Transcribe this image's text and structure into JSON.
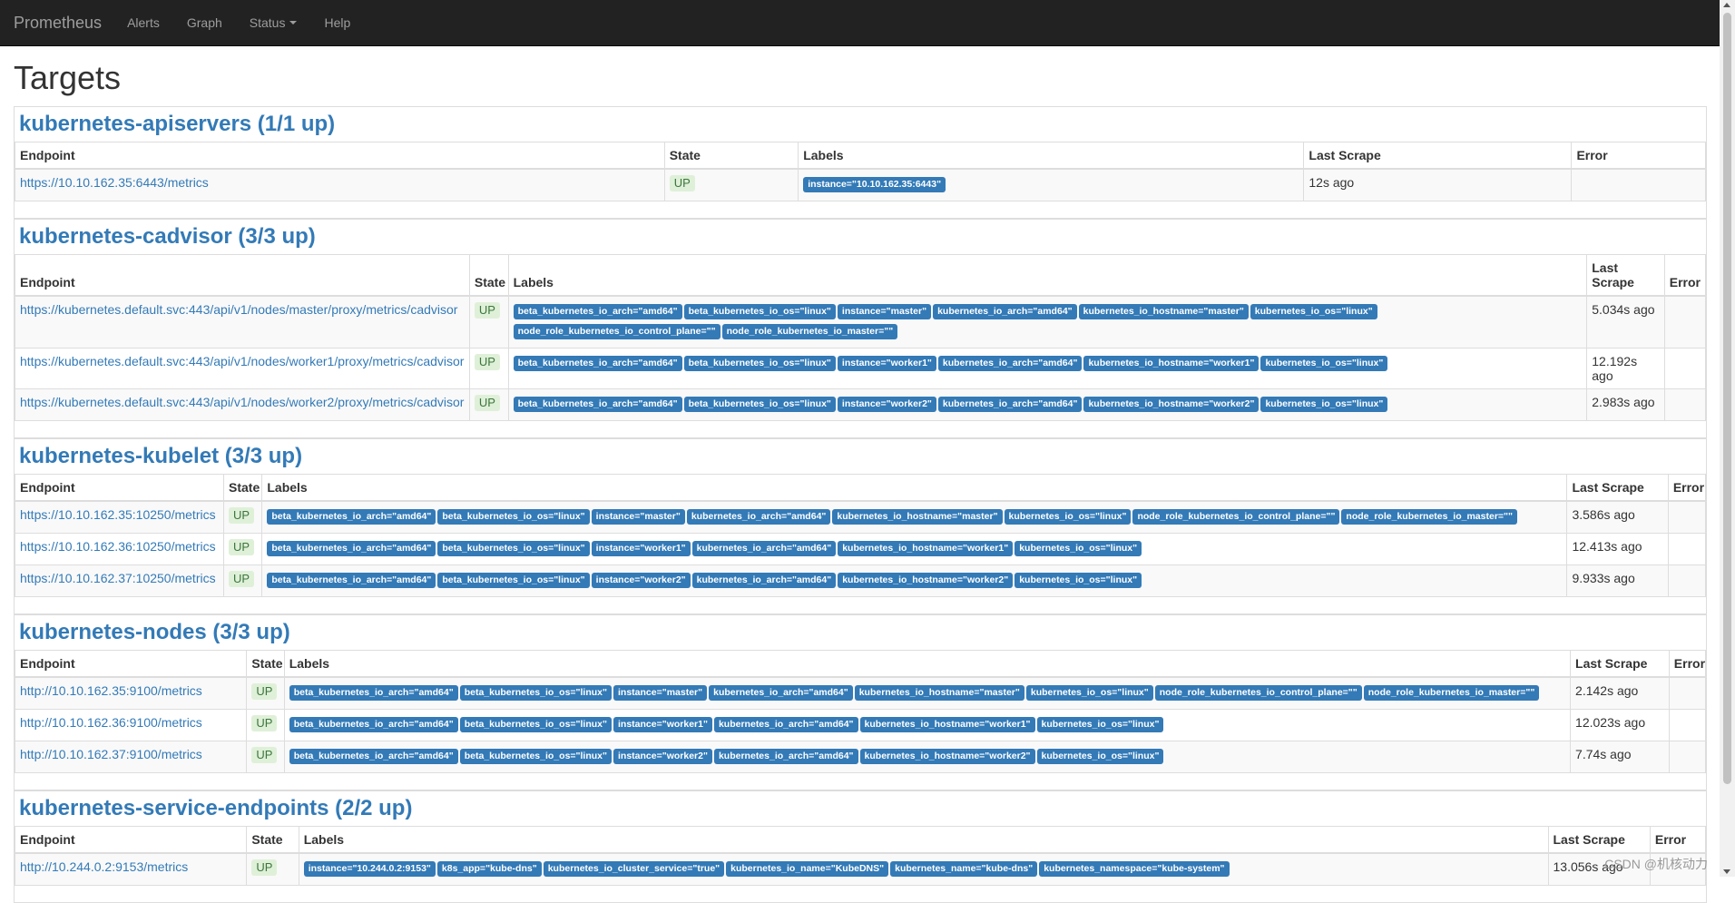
{
  "nav": {
    "brand": "Prometheus",
    "alerts": "Alerts",
    "graph": "Graph",
    "status": "Status",
    "help": "Help"
  },
  "page_title": "Targets",
  "sections": [
    {
      "title": "kubernetes-apiservers (1/1 up)",
      "headers": {
        "endpoint": "Endpoint",
        "state": "State",
        "labels": "Labels",
        "last_scrape": "Last Scrape",
        "error": "Error"
      },
      "rows": [
        {
          "endpoint": "https://10.10.162.35:6443/metrics",
          "state": "UP",
          "labels": [
            "instance=\"10.10.162.35:6443\""
          ],
          "last_scrape": "12s ago",
          "error": ""
        }
      ]
    },
    {
      "title": "kubernetes-cadvisor (3/3 up)",
      "headers": {
        "endpoint": "Endpoint",
        "state": "State",
        "labels": "Labels",
        "last_scrape": "Last Scrape",
        "error": "Error"
      },
      "rows": [
        {
          "endpoint": "https://kubernetes.default.svc:443/api/v1/nodes/master/proxy/metrics/cadvisor",
          "state": "UP",
          "labels": [
            "beta_kubernetes_io_arch=\"amd64\"",
            "beta_kubernetes_io_os=\"linux\"",
            "instance=\"master\"",
            "kubernetes_io_arch=\"amd64\"",
            "kubernetes_io_hostname=\"master\"",
            "kubernetes_io_os=\"linux\"",
            "node_role_kubernetes_io_control_plane=\"\"",
            "node_role_kubernetes_io_master=\"\""
          ],
          "last_scrape": "5.034s ago",
          "error": ""
        },
        {
          "endpoint": "https://kubernetes.default.svc:443/api/v1/nodes/worker1/proxy/metrics/cadvisor",
          "state": "UP",
          "labels": [
            "beta_kubernetes_io_arch=\"amd64\"",
            "beta_kubernetes_io_os=\"linux\"",
            "instance=\"worker1\"",
            "kubernetes_io_arch=\"amd64\"",
            "kubernetes_io_hostname=\"worker1\"",
            "kubernetes_io_os=\"linux\""
          ],
          "last_scrape": "12.192s ago",
          "error": ""
        },
        {
          "endpoint": "https://kubernetes.default.svc:443/api/v1/nodes/worker2/proxy/metrics/cadvisor",
          "state": "UP",
          "labels": [
            "beta_kubernetes_io_arch=\"amd64\"",
            "beta_kubernetes_io_os=\"linux\"",
            "instance=\"worker2\"",
            "kubernetes_io_arch=\"amd64\"",
            "kubernetes_io_hostname=\"worker2\"",
            "kubernetes_io_os=\"linux\""
          ],
          "last_scrape": "2.983s ago",
          "error": ""
        }
      ]
    },
    {
      "title": "kubernetes-kubelet (3/3 up)",
      "headers": {
        "endpoint": "Endpoint",
        "state": "State",
        "labels": "Labels",
        "last_scrape": "Last Scrape",
        "error": "Error"
      },
      "rows": [
        {
          "endpoint": "https://10.10.162.35:10250/metrics",
          "state": "UP",
          "labels": [
            "beta_kubernetes_io_arch=\"amd64\"",
            "beta_kubernetes_io_os=\"linux\"",
            "instance=\"master\"",
            "kubernetes_io_arch=\"amd64\"",
            "kubernetes_io_hostname=\"master\"",
            "kubernetes_io_os=\"linux\"",
            "node_role_kubernetes_io_control_plane=\"\"",
            "node_role_kubernetes_io_master=\"\""
          ],
          "last_scrape": "3.586s ago",
          "error": ""
        },
        {
          "endpoint": "https://10.10.162.36:10250/metrics",
          "state": "UP",
          "labels": [
            "beta_kubernetes_io_arch=\"amd64\"",
            "beta_kubernetes_io_os=\"linux\"",
            "instance=\"worker1\"",
            "kubernetes_io_arch=\"amd64\"",
            "kubernetes_io_hostname=\"worker1\"",
            "kubernetes_io_os=\"linux\""
          ],
          "last_scrape": "12.413s ago",
          "error": ""
        },
        {
          "endpoint": "https://10.10.162.37:10250/metrics",
          "state": "UP",
          "labels": [
            "beta_kubernetes_io_arch=\"amd64\"",
            "beta_kubernetes_io_os=\"linux\"",
            "instance=\"worker2\"",
            "kubernetes_io_arch=\"amd64\"",
            "kubernetes_io_hostname=\"worker2\"",
            "kubernetes_io_os=\"linux\""
          ],
          "last_scrape": "9.933s ago",
          "error": ""
        }
      ]
    },
    {
      "title": "kubernetes-nodes (3/3 up)",
      "headers": {
        "endpoint": "Endpoint",
        "state": "State",
        "labels": "Labels",
        "last_scrape": "Last Scrape",
        "error": "Error"
      },
      "rows": [
        {
          "endpoint": "http://10.10.162.35:9100/metrics",
          "state": "UP",
          "labels": [
            "beta_kubernetes_io_arch=\"amd64\"",
            "beta_kubernetes_io_os=\"linux\"",
            "instance=\"master\"",
            "kubernetes_io_arch=\"amd64\"",
            "kubernetes_io_hostname=\"master\"",
            "kubernetes_io_os=\"linux\"",
            "node_role_kubernetes_io_control_plane=\"\"",
            "node_role_kubernetes_io_master=\"\""
          ],
          "last_scrape": "2.142s ago",
          "error": ""
        },
        {
          "endpoint": "http://10.10.162.36:9100/metrics",
          "state": "UP",
          "labels": [
            "beta_kubernetes_io_arch=\"amd64\"",
            "beta_kubernetes_io_os=\"linux\"",
            "instance=\"worker1\"",
            "kubernetes_io_arch=\"amd64\"",
            "kubernetes_io_hostname=\"worker1\"",
            "kubernetes_io_os=\"linux\""
          ],
          "last_scrape": "12.023s ago",
          "error": ""
        },
        {
          "endpoint": "http://10.10.162.37:9100/metrics",
          "state": "UP",
          "labels": [
            "beta_kubernetes_io_arch=\"amd64\"",
            "beta_kubernetes_io_os=\"linux\"",
            "instance=\"worker2\"",
            "kubernetes_io_arch=\"amd64\"",
            "kubernetes_io_hostname=\"worker2\"",
            "kubernetes_io_os=\"linux\""
          ],
          "last_scrape": "7.74s ago",
          "error": ""
        }
      ]
    },
    {
      "title": "kubernetes-service-endpoints (2/2 up)",
      "headers": {
        "endpoint": "Endpoint",
        "state": "State",
        "labels": "Labels",
        "last_scrape": "Last Scrape",
        "error": "Error"
      },
      "rows": [
        {
          "endpoint": "http://10.244.0.2:9153/metrics",
          "state": "UP",
          "labels": [
            "instance=\"10.244.0.2:9153\"",
            "k8s_app=\"kube-dns\"",
            "kubernetes_io_cluster_service=\"true\"",
            "kubernetes_io_name=\"KubeDNS\"",
            "kubernetes_name=\"kube-dns\"",
            "kubernetes_namespace=\"kube-system\""
          ],
          "last_scrape": "13.056s ago",
          "error": ""
        }
      ]
    }
  ],
  "watermark": "CSDN @机核动力",
  "colors": {
    "navbar": "#222222",
    "link": "#337ab7",
    "label_bg": "#337ab7",
    "state_bg": "#dff0d8",
    "state_fg": "#3c763d"
  }
}
